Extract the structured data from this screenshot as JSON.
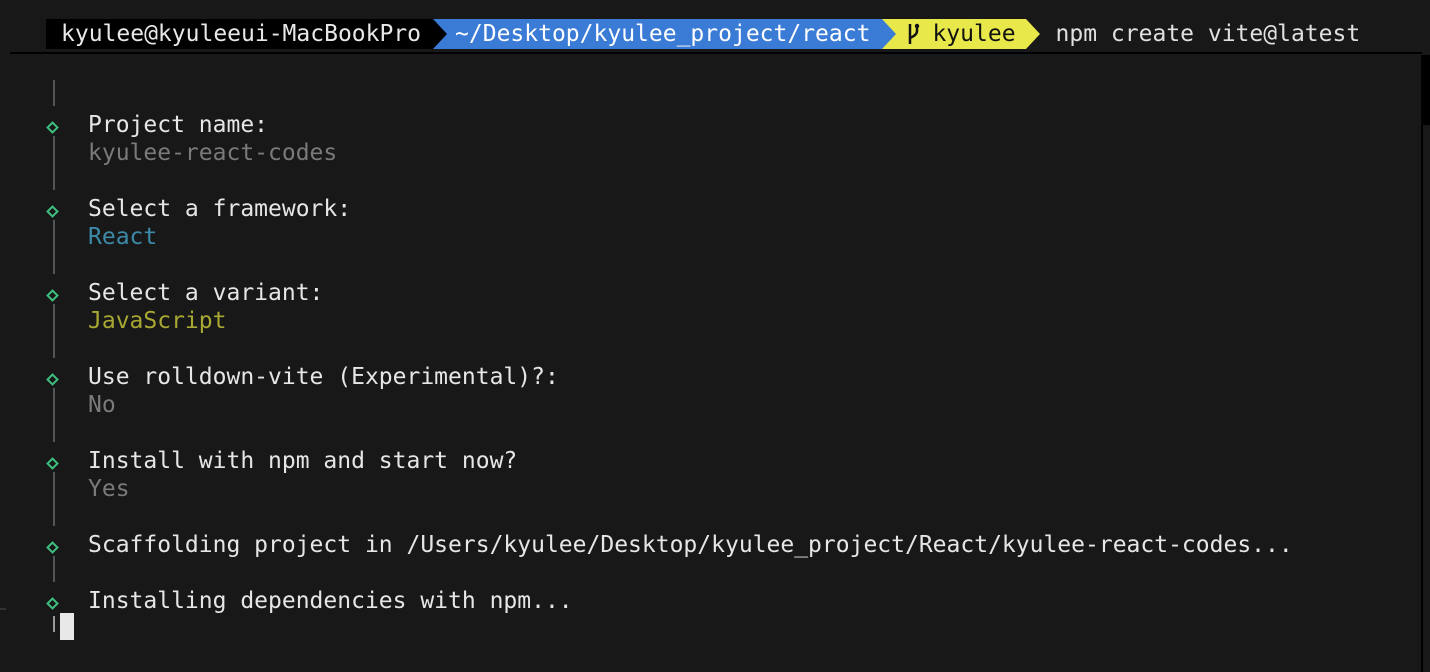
{
  "prompt": {
    "user_host": "kyulee@kyuleeui-MacBookPro",
    "directory": "~/Desktop/kyulee_project/react",
    "git_branch": "kyulee",
    "command": "npm create vite@latest",
    "colors": {
      "user_bg": "#000000",
      "dir_bg": "#3a7bd5",
      "git_bg": "#e8e84a"
    },
    "branch_icon": "git-branch-icon"
  },
  "steps": [
    {
      "label": "Project name:",
      "value": "kyulee-react-codes",
      "value_color": "#7a7a7a"
    },
    {
      "label": "Select a framework:",
      "value": "React",
      "value_color": "#3d8aa8"
    },
    {
      "label": "Select a variant:",
      "value": "JavaScript",
      "value_color": "#a8a833"
    },
    {
      "label": "Use rolldown-vite (Experimental)?:",
      "value": "No",
      "value_color": "#7a7a7a"
    },
    {
      "label": "Install with npm and start now?",
      "value": "Yes",
      "value_color": "#7a7a7a"
    },
    {
      "label": "Scaffolding project in /Users/kyulee/Desktop/kyulee_project/React/kyulee-react-codes...",
      "value": ""
    },
    {
      "label": "Installing dependencies with npm...",
      "value": ""
    }
  ],
  "accent_color": "#3fbf7f"
}
